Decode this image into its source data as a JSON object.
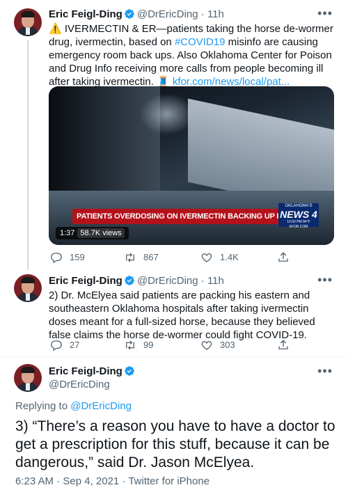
{
  "tweets": [
    {
      "name": "Eric Feigl-Ding",
      "handle": "@DrEricDing",
      "separator": "·",
      "time": "11h",
      "text_parts": {
        "warning_icon": "⚠️",
        "intro": " IVERMECTIN & ER—patients taking the horse de-wormer drug, ivermectin, based on ",
        "hashtag": "#COVID19",
        "rest": " misinfo are causing emergency room back ups. Also Oklahoma Center for Poison and Drug Info receiving more calls from people becoming ill after taking ivermectin. ",
        "emoji": "🧵",
        "link": " kfor.com/news/local/pat..."
      },
      "video": {
        "banner": "PATIENTS OVERDOSING ON IVERMECTIN BACKING UP RURAL HOSPITALS, AMBULANCES",
        "logo_top": "OKLAHOMA'S",
        "logo_main": "NEWS 4",
        "logo_bottom": "10:00 PM  84°F KFOR.COM",
        "duration": "1:37",
        "views": "58.7K views"
      },
      "stats": {
        "replies": "159",
        "retweets": "867",
        "likes": "1.4K"
      }
    },
    {
      "name": "Eric Feigl-Ding",
      "handle": "@DrEricDing",
      "separator": "·",
      "time": "11h",
      "text": "2) Dr. McElyea said patients are packing his eastern and southeastern Oklahoma hospitals after taking ivermectin doses meant for a full-sized horse, because they believed false claims the horse de-wormer could fight COVID-19.",
      "stats": {
        "replies": "27",
        "retweets": "99",
        "likes": "303"
      }
    }
  ],
  "main_tweet": {
    "name": "Eric Feigl-Ding",
    "handle": "@DrEricDing",
    "replying_prefix": "Replying to ",
    "replying_handle": "@DrEricDing",
    "text": "3) “There’s a reason you have to have a doctor to get a prescription for this stuff, because it can be dangerous,” said Dr. Jason McElyea.",
    "timestamp": "6:23 AM · Sep 4, 2021 · Twitter for iPhone"
  },
  "colors": {
    "accent": "#1d9bf0",
    "secondary_text": "#536471",
    "banner_red": "#b3121b"
  },
  "icons": [
    "verified-badge-icon",
    "more-icon",
    "reply-icon",
    "retweet-icon",
    "like-icon",
    "share-icon"
  ]
}
